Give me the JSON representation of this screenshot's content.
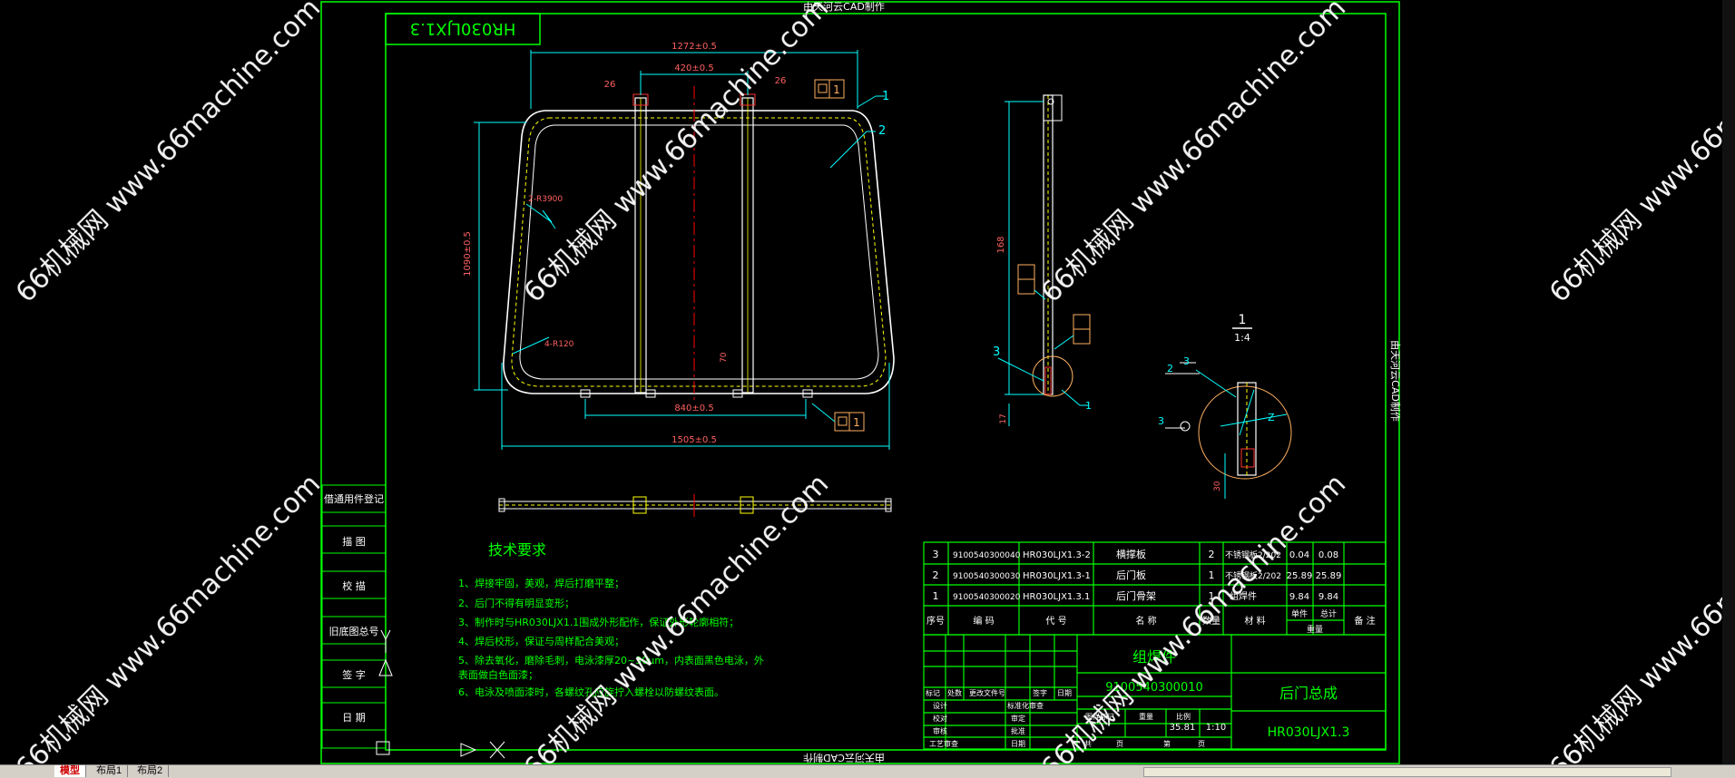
{
  "title_strip": "由天河云CAD制作",
  "title_strip_side": "由天河云CAD制作",
  "title_strip_bottom": "由天河云CAD制作",
  "drawing_no_mirrored": "HR030LJX1.3",
  "dims": {
    "top_overall": "1272±0.5",
    "inner_spacing": "420±0.5",
    "slot_left": "26",
    "slot_right": "26",
    "height": "1090±0.5",
    "corner_r1": "2-R3900",
    "corner_r2": "4-R120",
    "bottom_spacing": "840±0.5",
    "bottom_overall": "1505±0.5",
    "small_70": "70",
    "side_height": "168",
    "side_17": "17",
    "detail_30": "30",
    "flag_1": "1",
    "balloon_1": "1",
    "balloon_2": "2",
    "balloon_3": "3",
    "detail_label_num": "1",
    "detail_label_scale": "1:4",
    "detail_2": "2",
    "detail_3a": "3",
    "detail_3b": "3",
    "detail_z": "Z"
  },
  "tech": {
    "title": "技术要求",
    "items": [
      "1、焊接牢固，美观，焊后打磨平整；",
      "2、后门不得有明显变形；",
      "3、制作时与HR030LJX1.1围成外形配作，保证外形轮廓相符；",
      "4、焊后校形，保证与周样配合美观；",
      "5、除去氧化，磨除毛刺，电泳漆厚20~30μm，内表面黑色电泳，外",
      "   表面做白色面漆；",
      "6、电泳及喷面漆时，各螺纹孔应旋拧入螺栓以防螺纹表面。"
    ]
  },
  "left_block": [
    "借通用件登记",
    "描  图",
    "校  描",
    "旧底图总号",
    "签  字",
    "日  期"
  ],
  "bom": {
    "rows": [
      {
        "seq": "3",
        "code": "9100540300040",
        "drawing": "HR030LJX1.3-2",
        "name": "横撑板",
        "qty": "2",
        "material": "不锈钢板2/202",
        "unit": "0.04",
        "total": "0.08"
      },
      {
        "seq": "2",
        "code": "9100540300030",
        "drawing": "HR030LJX1.3-1",
        "name": "后门板",
        "qty": "1",
        "material": "不锈钢板2/202",
        "unit": "25.89",
        "total": "25.89"
      },
      {
        "seq": "1",
        "code": "9100540300020",
        "drawing": "HR030LJX1.3.1",
        "name": "后门骨架",
        "qty": "1",
        "material": "组焊件",
        "unit": "9.84",
        "total": "9.84"
      }
    ],
    "header": {
      "seq": "序号",
      "code": "编  码",
      "drawing": "代  号",
      "name": "名  称",
      "qty": "数量",
      "material": "材  料",
      "unit": "单件",
      "total": "总计",
      "weight": "重量",
      "remark": "备  注"
    }
  },
  "titleblock": {
    "type": "组焊件",
    "code": "9100540300010",
    "name": "后门总成",
    "drawing_no": "HR030LJX1.3",
    "weight": "35.81",
    "scale": "1:10",
    "labels": [
      "标记",
      "处数",
      "更改文件号",
      "签字",
      "日期",
      "设计",
      "校对",
      "审核",
      "工艺审查",
      "标准化审查",
      "审定",
      "批准",
      "日期",
      "图样标记",
      "重量",
      "比例",
      "共",
      "页",
      "第",
      "页"
    ]
  },
  "watermarks": [
    "66机械网 www.66machine.com"
  ],
  "tabs": [
    "模型",
    "布局1",
    "布局2"
  ],
  "colors": {
    "frame": "#00ff00",
    "line": "#ffffff",
    "dim": "#00ffff",
    "accent": "#ff0000",
    "yellow": "#ffff00",
    "label": "#ffb060"
  }
}
